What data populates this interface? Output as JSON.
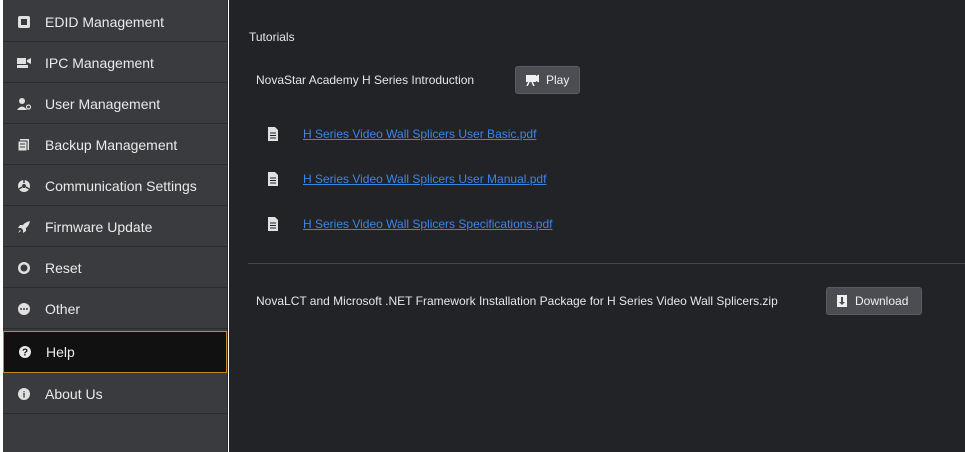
{
  "sidebar": {
    "items": [
      {
        "label": "EDID Management",
        "icon": "edid-icon"
      },
      {
        "label": "IPC Management",
        "icon": "ipc-icon"
      },
      {
        "label": "User Management",
        "icon": "user-icon"
      },
      {
        "label": "Backup Management",
        "icon": "backup-icon"
      },
      {
        "label": "Communication Settings",
        "icon": "communication-icon"
      },
      {
        "label": "Firmware Update",
        "icon": "rocket-icon"
      },
      {
        "label": "Reset",
        "icon": "reset-icon"
      },
      {
        "label": "Other",
        "icon": "other-icon"
      },
      {
        "label": "Help",
        "icon": "help-icon",
        "active": true
      },
      {
        "label": "About Us",
        "icon": "info-icon"
      }
    ]
  },
  "main": {
    "tutorials_title": "Tutorials",
    "intro_text": "NovaStar Academy H Series Introduction",
    "play_label": "Play",
    "documents": [
      "H Series Video Wall Splicers User Basic.pdf",
      "H Series Video Wall Splicers User Manual.pdf",
      "H Series Video Wall Splicers Specifications.pdf"
    ],
    "package_text": "NovaLCT and Microsoft .NET Framework Installation Package for H Series Video Wall Splicers.zip",
    "download_label": "Download"
  },
  "colors": {
    "sidebar_bg": "#3a3b3e",
    "main_bg": "#222327",
    "active_border": "#c9871f",
    "link": "#3a86e8"
  }
}
